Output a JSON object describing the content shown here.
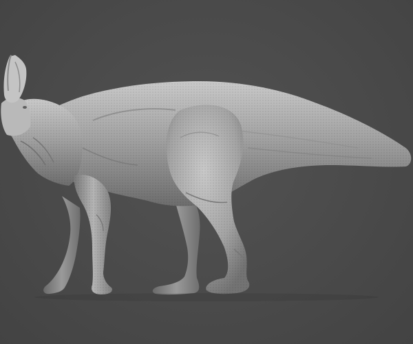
{
  "scene": {
    "subject_icon": "hadrosaur-sculpt-icon",
    "background_color": "#4a4a4a",
    "material_color": "#9b9b9b"
  }
}
